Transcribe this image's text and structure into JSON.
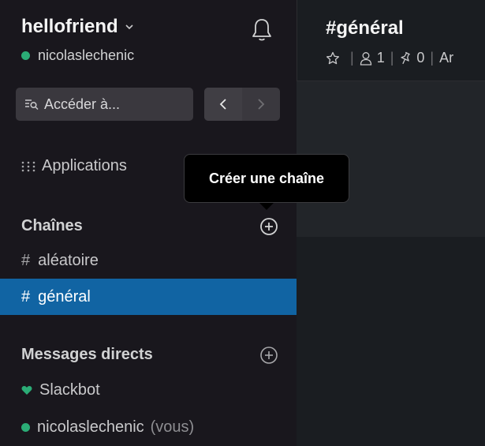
{
  "workspace": {
    "name": "hellofriend",
    "user": "nicolaslechenic",
    "status_color": "#2bac76"
  },
  "search": {
    "placeholder": "Accéder à..."
  },
  "apps": {
    "label": "Applications"
  },
  "tooltip": {
    "text": "Créer une chaîne"
  },
  "channels": {
    "title": "Chaînes",
    "items": [
      {
        "hash": "#",
        "label": "aléatoire",
        "active": false
      },
      {
        "hash": "#",
        "label": "général",
        "active": true
      }
    ]
  },
  "direct_messages": {
    "title": "Messages directs",
    "items": [
      {
        "label": "Slackbot",
        "icon": "heart-icon"
      },
      {
        "label": "nicolaslechenic",
        "suffix": "(vous)",
        "icon": "online-dot"
      }
    ]
  },
  "channel_header": {
    "title": "#général",
    "separator": "|",
    "members": "1",
    "pins": "0",
    "topic_fragment": "Ar"
  },
  "colors": {
    "sidebar_bg": "#19171d",
    "active_channel": "#1164a3",
    "online": "#2bac76",
    "main_bg": "#1a1d21"
  }
}
